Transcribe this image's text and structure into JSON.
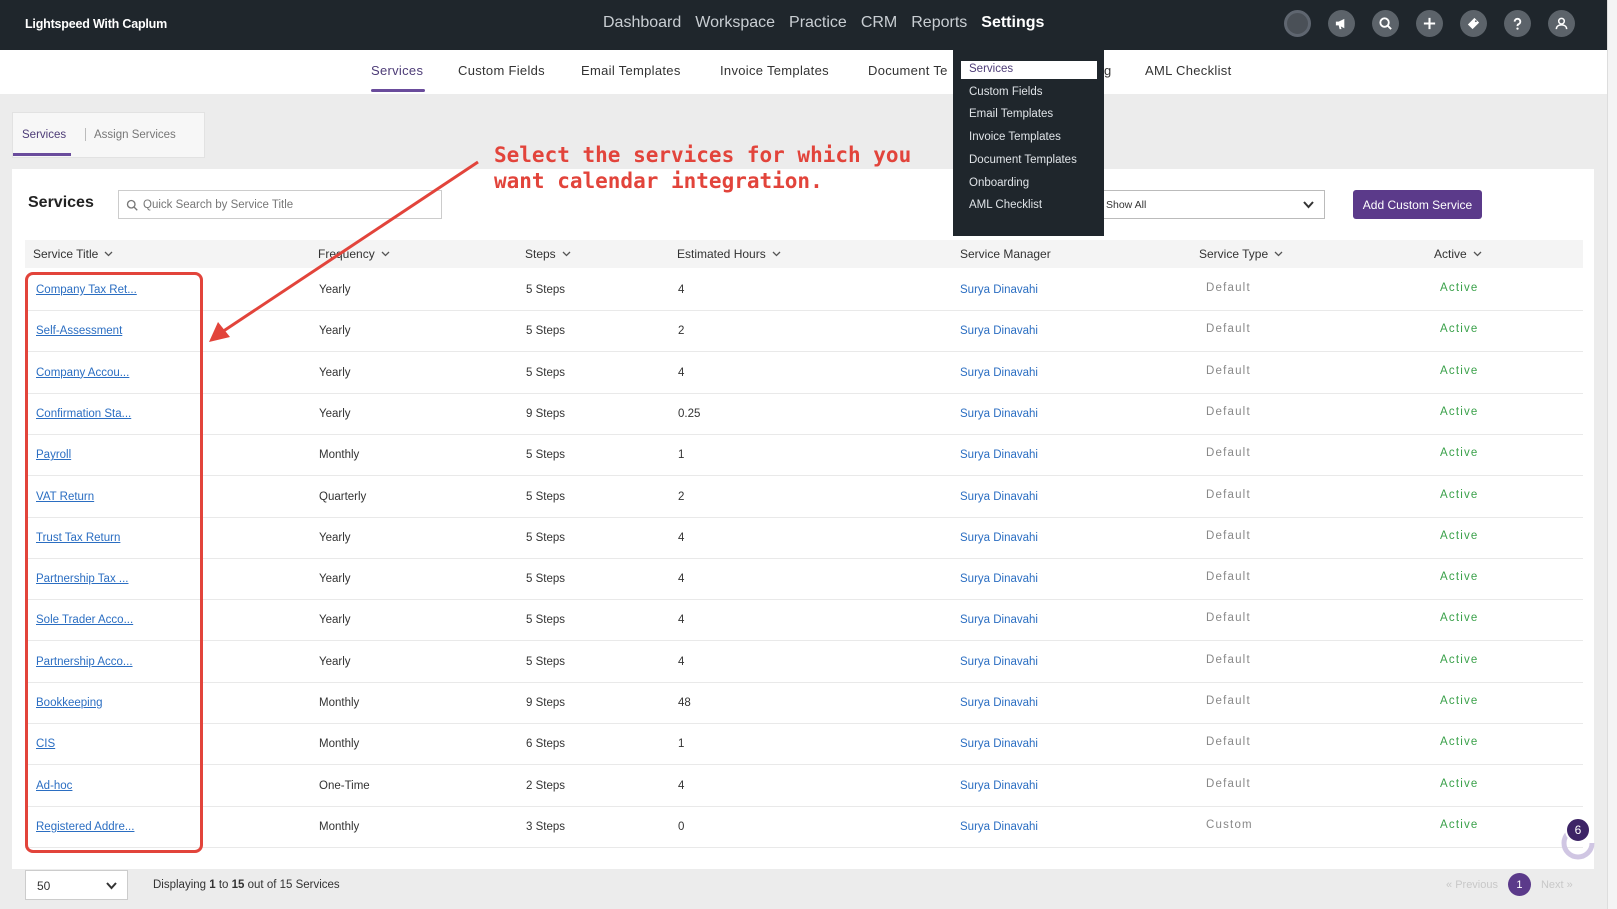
{
  "app": {
    "brand": "Lightspeed With Caplum"
  },
  "main_nav": [
    "Dashboard",
    "Workspace",
    "Practice",
    "CRM",
    "Reports",
    "Settings"
  ],
  "top_icons": [
    "circle-status-icon",
    "megaphone-icon",
    "search-icon",
    "plus-icon",
    "tag-icon",
    "help-icon",
    "user-icon"
  ],
  "sub_nav": {
    "tabs": [
      "Services",
      "Custom Fields",
      "Email Templates",
      "Invoice Templates",
      "Document Te",
      "g",
      "AML Checklist"
    ]
  },
  "settings_menu": {
    "items": [
      "Services",
      "Custom Fields",
      "Email Templates",
      "Invoice Templates",
      "Document Templates",
      "Onboarding",
      "AML Checklist"
    ]
  },
  "service_tabs": {
    "services": "Services",
    "assign": "Assign Services"
  },
  "page": {
    "title": "Services",
    "search_placeholder": "Quick Search by Service Title",
    "filter_value": "Show All",
    "add_button": "Add Custom Service"
  },
  "table": {
    "headers": [
      "Service Title",
      "Frequency",
      "Steps",
      "Estimated Hours",
      "Service Manager",
      "Service Type",
      "Active"
    ],
    "rows": [
      [
        "Company Tax Ret...",
        "Yearly",
        "5 Steps",
        "4",
        "Surya Dinavahi",
        "Default",
        "Active"
      ],
      [
        "Self-Assessment",
        "Yearly",
        "5 Steps",
        "2",
        "Surya Dinavahi",
        "Default",
        "Active"
      ],
      [
        "Company Accou...",
        "Yearly",
        "5 Steps",
        "4",
        "Surya Dinavahi",
        "Default",
        "Active"
      ],
      [
        "Confirmation Sta...",
        "Yearly",
        "9 Steps",
        "0.25",
        "Surya Dinavahi",
        "Default",
        "Active"
      ],
      [
        "Payroll",
        "Monthly",
        "5 Steps",
        "1",
        "Surya Dinavahi",
        "Default",
        "Active"
      ],
      [
        "VAT Return",
        "Quarterly",
        "5 Steps",
        "2",
        "Surya Dinavahi",
        "Default",
        "Active"
      ],
      [
        "Trust Tax Return",
        "Yearly",
        "5 Steps",
        "4",
        "Surya Dinavahi",
        "Default",
        "Active"
      ],
      [
        "Partnership Tax ...",
        "Yearly",
        "5 Steps",
        "4",
        "Surya Dinavahi",
        "Default",
        "Active"
      ],
      [
        "Sole Trader Acco...",
        "Yearly",
        "5 Steps",
        "4",
        "Surya Dinavahi",
        "Default",
        "Active"
      ],
      [
        "Partnership Acco...",
        "Yearly",
        "5 Steps",
        "4",
        "Surya Dinavahi",
        "Default",
        "Active"
      ],
      [
        "Bookkeeping",
        "Monthly",
        "9 Steps",
        "48",
        "Surya Dinavahi",
        "Default",
        "Active"
      ],
      [
        "CIS",
        "Monthly",
        "6 Steps",
        "1",
        "Surya Dinavahi",
        "Default",
        "Active"
      ],
      [
        "Ad-hoc",
        "One-Time",
        "2 Steps",
        "4",
        "Surya Dinavahi",
        "Default",
        "Active"
      ],
      [
        "Registered Addre...",
        "Monthly",
        "3 Steps",
        "0",
        "Surya Dinavahi",
        "Custom",
        "Active"
      ]
    ]
  },
  "footer": {
    "page_size": "50",
    "displaying_prefix": "Displaying ",
    "range_start": "1",
    "range_mid": " to ",
    "range_end": "15",
    "displaying_suffix": " out of 15 Services",
    "previous": "Previous",
    "current_page": "1",
    "next": "Next"
  },
  "annotation": {
    "line1": "Select the services for which you",
    "line2": "want calendar integration."
  },
  "widget": {
    "badge_count": "6"
  },
  "colors": {
    "topbar": "#1f262c",
    "accent": "#5b3a8a",
    "annotation": "#e2443b",
    "link": "#2b6ec2",
    "active": "#3aa14a"
  }
}
